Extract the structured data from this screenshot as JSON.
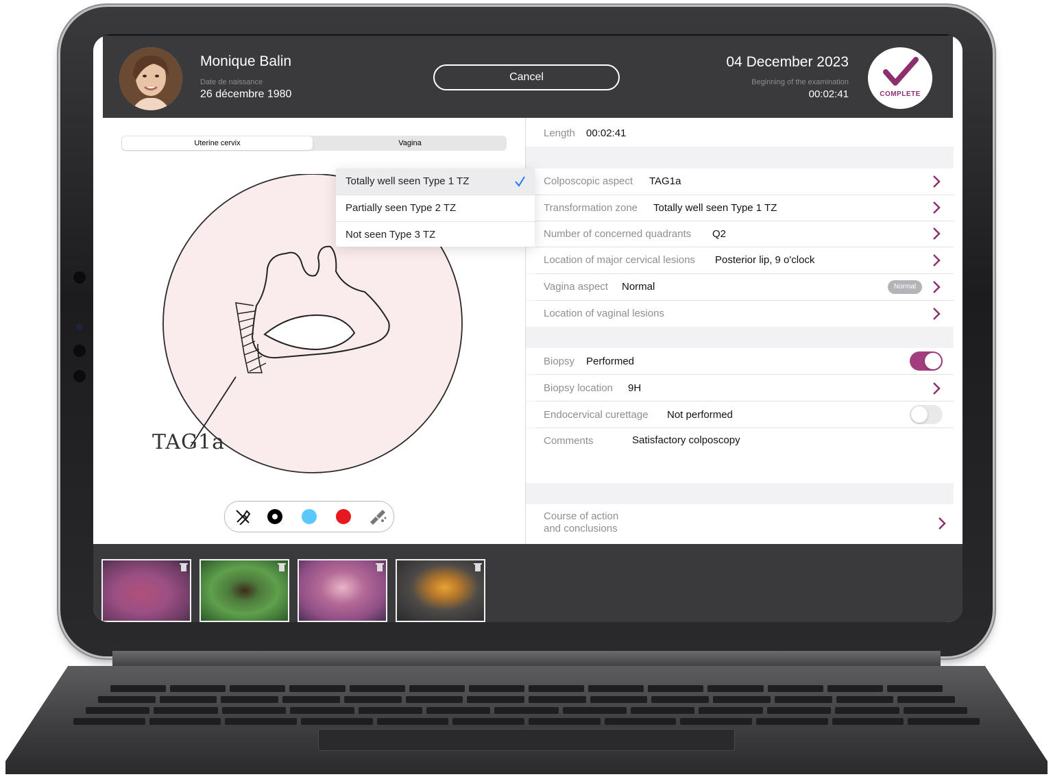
{
  "patient": {
    "name": "Monique Balin",
    "dob_label": "Date de naissance",
    "dob": "26 décembre 1980"
  },
  "header": {
    "cancel_label": "Cancel",
    "exam_date": "04 December 2023",
    "exam_label": "Beginning of the examination",
    "exam_time": "00:02:41",
    "status": "COMPLETE"
  },
  "segments": [
    "Uterine cervix",
    "Vagina"
  ],
  "drawing_label": "TAG1a",
  "dropdown": {
    "items": [
      "Totally well seen Type 1 TZ",
      "Partially seen Type 2 TZ",
      "Not seen Type 3 TZ"
    ],
    "selected": "Totally well seen Type 1 TZ"
  },
  "tools": [
    "eraser-icon",
    "black-pen",
    "blue-pen",
    "red-pen",
    "clear-icon"
  ],
  "colors": {
    "accent": "#a23d7e",
    "black": "#000000",
    "blue": "#5ac8fa",
    "red": "#e8181f"
  },
  "form": {
    "length": {
      "label": "Length",
      "value": "00:02:41"
    },
    "colposcopic": {
      "label": "Colposcopic aspect",
      "value": "TAG1a"
    },
    "tz": {
      "label": "Transformation zone",
      "value": "Totally well seen Type 1 TZ"
    },
    "quadrants": {
      "label": "Number of concerned quadrants",
      "value": "Q2"
    },
    "major_lesions": {
      "label": "Location of major cervical lesions",
      "value": "Posterior lip, 9 o'clock"
    },
    "vagina": {
      "label": "Vagina aspect",
      "value": "Normal",
      "badge": "Normal"
    },
    "vaginal_lesions": {
      "label": "Location of vaginal lesions"
    },
    "biopsy": {
      "label": "Biopsy",
      "value": "Performed",
      "on": true
    },
    "biopsy_location": {
      "label": "Biopsy location",
      "value": "9H"
    },
    "curettage": {
      "label": "Endocervical curettage",
      "value": "Not performed",
      "on": false
    },
    "comments": {
      "label": "Comments",
      "value": "Satisfactory colposcopy"
    },
    "course": {
      "label_line1": "Course of action",
      "label_line2": "and conclusions"
    }
  },
  "thumbnails": [
    "cervix-photo-1",
    "cervix-photo-green-filter",
    "cervix-photo-2",
    "cervix-photo-iodine"
  ]
}
